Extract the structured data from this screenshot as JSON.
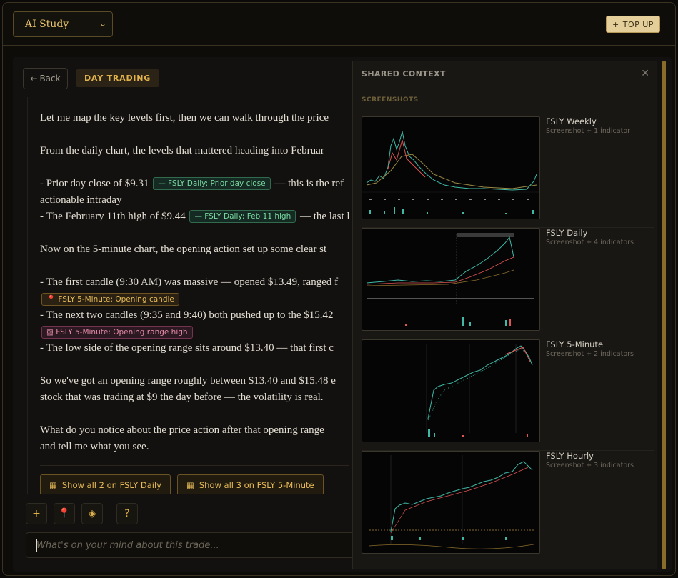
{
  "header": {
    "model_select": "AI Study",
    "topup_label": "TOP UP"
  },
  "subbar": {
    "back_label": "Back",
    "topic": "DAY TRADING"
  },
  "message": {
    "p1": "Let me map the key levels first, then we can walk through the price",
    "p2": "From the daily chart, the levels that mattered heading into Februar",
    "l1a": "- Prior day close of $9.31",
    "tag1": "— FSLY Daily: Prior day close",
    "l1b": "— this is the ref",
    "l1c": "actionable intraday",
    "l2a": "- The February 11th high of $9.44",
    "tag2": "— FSLY Daily: Feb 11 high",
    "l2b": "— the last l",
    "p3": "Now on the 5-minute chart, the opening action set up some clear st",
    "l3": "- The first candle (9:30 AM) was massive — opened $13.49, ranged f",
    "tag3": "📍 FSLY 5-Minute: Opening candle",
    "l4": "- The next two candles (9:35 and 9:40) both pushed up to the $15.42",
    "tag4": "▨ FSLY 5-Minute: Opening range high",
    "l5": "- The low side of the opening range sits around $13.40 — that first c",
    "p4a": "So we've got an opening range roughly between $13.40 and $15.48 e",
    "p4b": "stock that was trading at $9 the day before — the volatility is real.",
    "p5a": "What do you notice about the price action after that opening range",
    "p5b": "and tell me what you see."
  },
  "show_buttons": {
    "daily": "Show all 2 on FSLY Daily",
    "five_min": "Show all 3 on FSLY 5-Minute"
  },
  "composer": {
    "placeholder": "What's on your mind about this trade..."
  },
  "context_panel": {
    "title": "SHARED CONTEXT",
    "section": "SCREENSHOTS",
    "shots": [
      {
        "name": "FSLY Weekly",
        "sub": "Screenshot + 1 indicator"
      },
      {
        "name": "FSLY Daily",
        "sub": "Screenshot + 4 indicators"
      },
      {
        "name": "FSLY 5-Minute",
        "sub": "Screenshot + 2 indicators"
      },
      {
        "name": "FSLY Hourly",
        "sub": "Screenshot + 3 indicators"
      }
    ]
  },
  "colors": {
    "accent_gold": "#e2b24a",
    "tag_green": "#79d7a0",
    "tag_pink": "#e38aa8",
    "candle_up": "#3fb9a6",
    "candle_down": "#e05454"
  }
}
